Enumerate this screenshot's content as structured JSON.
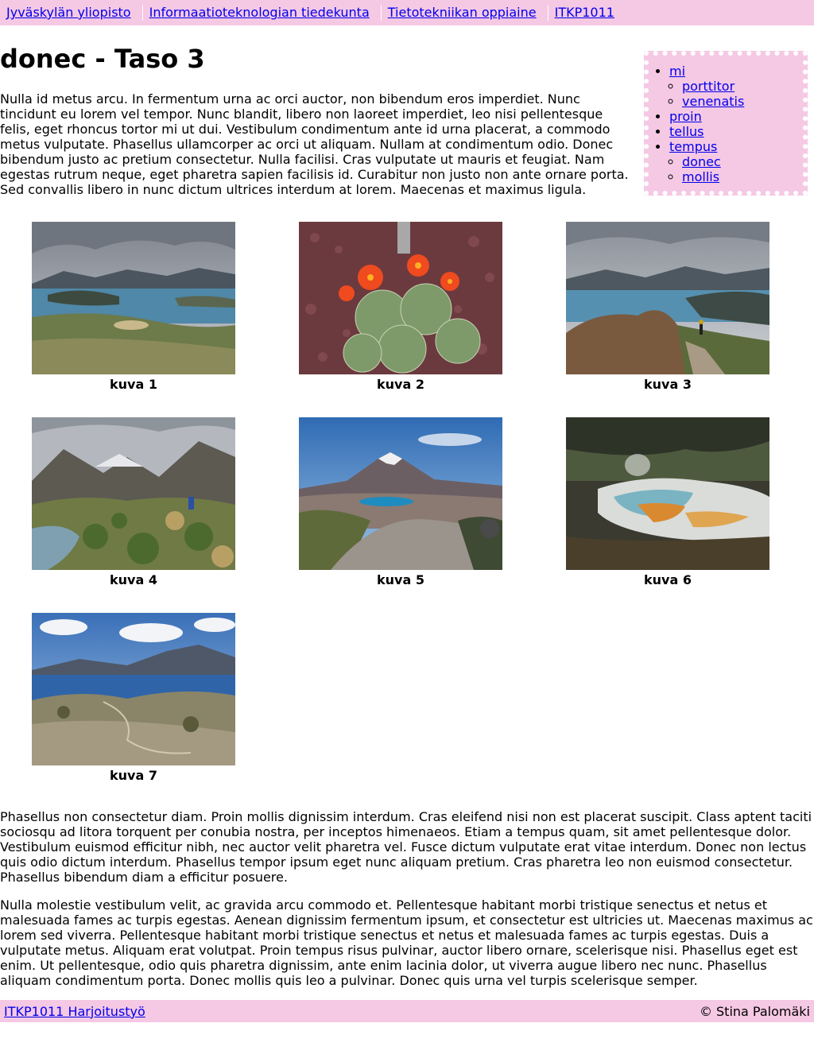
{
  "breadcrumb": [
    {
      "label": "Jyväskylän yliopisto"
    },
    {
      "label": "Informaatioteknologian tiedekunta"
    },
    {
      "label": "Tietotekniikan oppiaine"
    },
    {
      "label": "ITKP1011"
    }
  ],
  "page": {
    "title": "donec - Taso 3",
    "intro": "Nulla id metus arcu. In fermentum urna ac orci auctor, non bibendum eros imperdiet. Nunc tincidunt eu lorem vel tempor. Nunc blandit, libero non laoreet imperdiet, leo nisi pellentesque felis, eget rhoncus tortor mi ut dui. Vestibulum condimentum ante id urna placerat, a commodo metus vulputate. Phasellus ullamcorper ac orci ut aliquam. Nullam at condimentum odio. Donec bibendum justo ac pretium consectetur. Nulla facilisi. Cras vulputate ut mauris et feugiat. Nam egestas rutrum neque, eget pharetra sapien facilisis id. Curabitur non justo non ante ornare porta. Sed convallis libero in nunc dictum ultrices interdum at lorem. Maecenas et maximus ligula.",
    "para2": "Phasellus non consectetur diam. Proin mollis dignissim interdum. Cras eleifend nisi non est placerat suscipit. Class aptent taciti sociosqu ad litora torquent per conubia nostra, per inceptos himenaeos. Etiam a tempus quam, sit amet pellentesque dolor. Vestibulum euismod efficitur nibh, nec auctor velit pharetra vel. Fusce dictum vulputate erat vitae interdum. Donec non lectus quis odio dictum interdum. Phasellus tempor ipsum eget nunc aliquam pretium. Cras pharetra leo non euismod consectetur. Phasellus bibendum diam a efficitur posuere.",
    "para3": "Nulla molestie vestibulum velit, ac gravida arcu commodo et. Pellentesque habitant morbi tristique senectus et netus et malesuada fames ac turpis egestas. Aenean dignissim fermentum ipsum, et consectetur est ultricies ut. Maecenas maximus ac lorem sed viverra. Pellentesque habitant morbi tristique senectus et netus et malesuada fames ac turpis egestas. Duis a vulputate metus. Aliquam erat volutpat. Proin tempus risus pulvinar, auctor libero ornare, scelerisque nisi. Phasellus eget est enim. Ut pellentesque, odio quis pharetra dignissim, ante enim lacinia dolor, ut viverra augue libero nec nunc. Phasellus aliquam condimentum porta. Donec mollis quis leo a pulvinar. Donec quis urna vel turpis scelerisque semper."
  },
  "toc": {
    "items": [
      {
        "label": "mi",
        "children": [
          {
            "label": "porttitor"
          },
          {
            "label": "venenatis"
          }
        ]
      },
      {
        "label": "proin",
        "children": []
      },
      {
        "label": "tellus",
        "children": []
      },
      {
        "label": "tempus",
        "children": [
          {
            "label": "donec"
          },
          {
            "label": "mollis"
          }
        ]
      }
    ]
  },
  "gallery": [
    {
      "caption": "kuva 1"
    },
    {
      "caption": "kuva 2"
    },
    {
      "caption": "kuva 3"
    },
    {
      "caption": "kuva 4"
    },
    {
      "caption": "kuva 5"
    },
    {
      "caption": "kuva 6"
    },
    {
      "caption": "kuva 7"
    }
  ],
  "footer": {
    "link": "ITKP1011 Harjoitustyö",
    "copyright": "© Stina Palomäki"
  }
}
